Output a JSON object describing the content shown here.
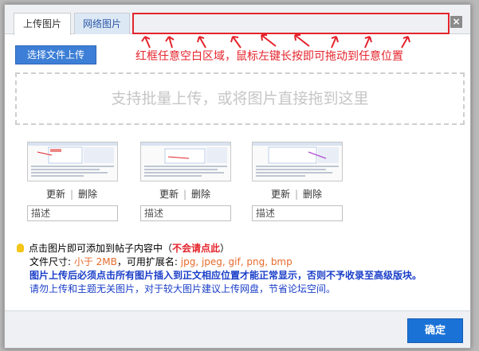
{
  "tabs": [
    {
      "label": "上传图片",
      "active": true
    },
    {
      "label": "网络图片",
      "active": false
    }
  ],
  "close_label": "×",
  "drag_hint": "红框任意空白区域，鼠标左键长按即可拖动到任意位置",
  "upload_button": "选择文件上传",
  "dropzone_text": "支持批量上传，或将图片直接拖到这里",
  "images": [
    {
      "update": "更新",
      "separator": "|",
      "delete": "删除",
      "desc_placeholder": "描述"
    },
    {
      "update": "更新",
      "separator": "|",
      "delete": "删除",
      "desc_placeholder": "描述"
    },
    {
      "update": "更新",
      "separator": "|",
      "delete": "删除",
      "desc_placeholder": "描述"
    }
  ],
  "notes": {
    "line1_prefix": "点击图片即可添加到帖子内容中（",
    "line1_warn": "不会请点此",
    "line1_suffix": "）",
    "line2_prefix": "文件尺寸: ",
    "line2_size": "小于 2MB",
    "line2_mid": "，可用扩展名: ",
    "line2_ext": "jpg, jpeg, gif, png, bmp",
    "line3": "图片上传后必须点击所有图片插入到正文相应位置才能正常显示，否则不予收录至高级版块。",
    "line4": "请勿上传和主题无关图片，对于较大图片建议上传网盘，节省论坛空间。"
  },
  "ok_button": "确定",
  "colors": {
    "accent": "#1b72d6",
    "warning": "#e4242c",
    "info": "#1a3ec9"
  }
}
